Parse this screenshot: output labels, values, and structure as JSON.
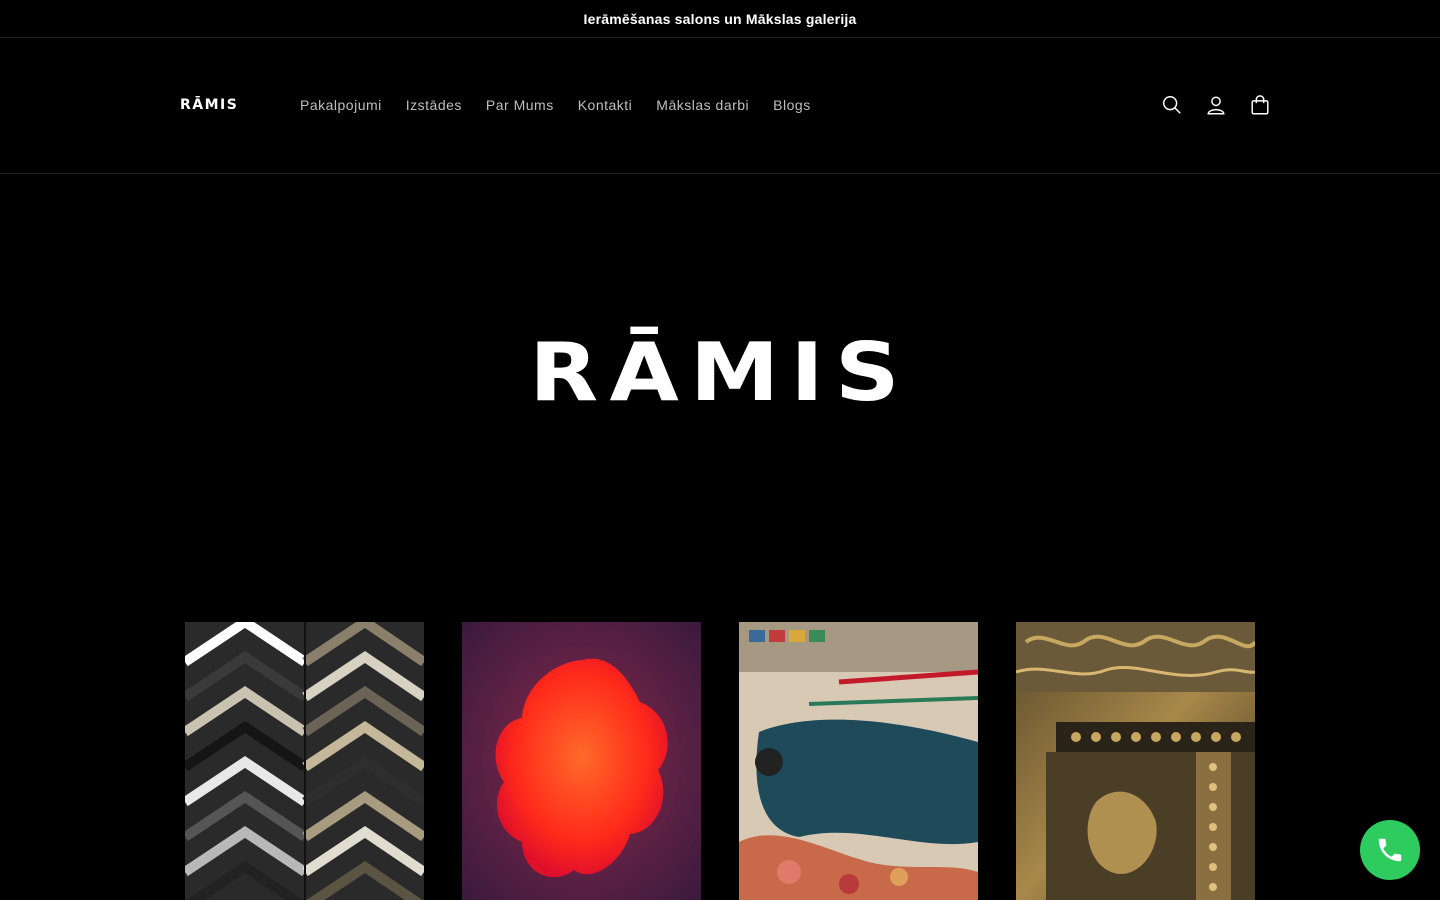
{
  "announcement": {
    "text": "Ierāmēšanas salons un Mākslas galerija"
  },
  "header": {
    "logo_text": "RĀMIS",
    "nav": [
      {
        "label": "Pakalpojumi"
      },
      {
        "label": "Izstādes"
      },
      {
        "label": "Par Mums"
      },
      {
        "label": "Kontakti"
      },
      {
        "label": "Mākslas darbi"
      },
      {
        "label": "Blogs"
      }
    ],
    "icons": [
      "search-icon",
      "account-icon",
      "cart-icon"
    ]
  },
  "hero": {
    "logo_text": "RĀMIS"
  },
  "cards": [
    {
      "image": "frame-corner-samples"
    },
    {
      "image": "red-abstract-painting"
    },
    {
      "image": "watercolor-palette"
    },
    {
      "image": "ornate-gold-frame"
    }
  ],
  "floating": {
    "icon": "phone-icon",
    "color": "#2ecc5e"
  },
  "colors": {
    "background": "#000000",
    "text": "#ffffff",
    "nav_text": "#bfbfbf",
    "accent_green": "#2ecc5e"
  }
}
